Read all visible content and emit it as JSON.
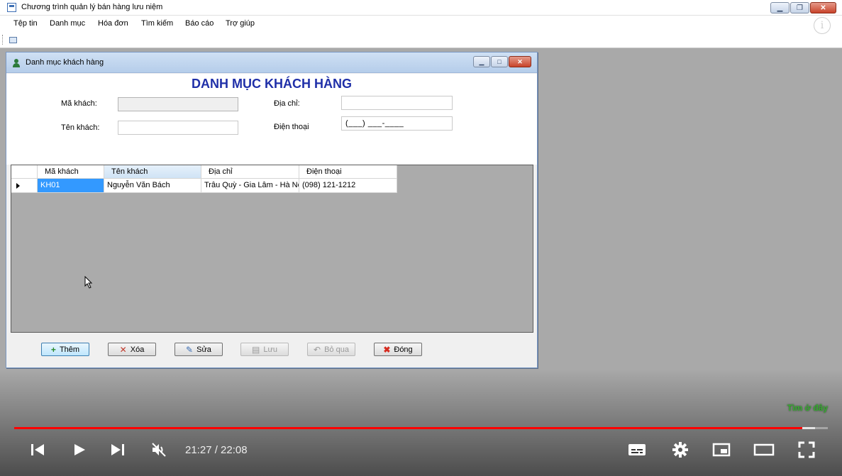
{
  "app": {
    "title": "Chương trình quản lý bán hàng lưu niệm",
    "menu": [
      "Tệp tin",
      "Danh mục",
      "Hóa đơn",
      "Tìm kiếm",
      "Báo cáo",
      "Trợ giúp"
    ]
  },
  "dialog": {
    "title": "Danh mục khách hàng",
    "heading": "DANH MỤC KHÁCH HÀNG",
    "fields": {
      "ma_khach_label": "Mã khách:",
      "ma_khach_value": "",
      "ten_khach_label": "Tên khách:",
      "ten_khach_value": "",
      "dia_chi_label": "Địa chỉ:",
      "dia_chi_value": "",
      "dien_thoai_label": "Điện thoại",
      "dien_thoai_value": "(___) ___-____"
    },
    "grid": {
      "columns": [
        "Mã khách",
        "Tên khách",
        "Địa chỉ",
        "Điện thoại"
      ],
      "rows": [
        [
          "KH01",
          "Nguyễn Văn Bách",
          "Trâu Quỳ - Gia Lâm - Hà Nội",
          "(098) 121-1212"
        ]
      ]
    },
    "buttons": {
      "them": "Thêm",
      "xoa": "Xóa",
      "sua": "Sửa",
      "luu": "Lưu",
      "bo_qua": "Bỏ qua",
      "dong": "Đóng"
    }
  },
  "player": {
    "current_time": "21:27",
    "duration": "22:08",
    "time_display": "21:27 / 22:08",
    "progress_fraction": 0.969,
    "watermark": "Tìm ở đây"
  },
  "colors": {
    "heading": "#1f2fa8",
    "selection": "#3399ff",
    "progress": "#ff0000"
  }
}
